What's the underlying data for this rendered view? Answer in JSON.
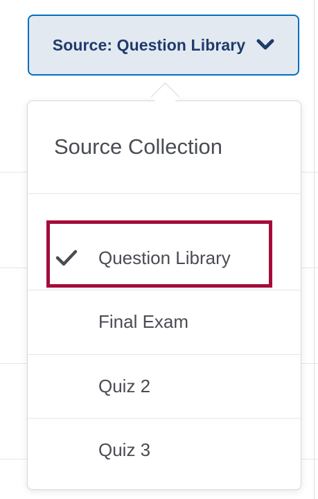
{
  "source_button": {
    "label": "Source: Question Library",
    "icon": "chevron-down-icon",
    "colors": {
      "background": "#e3e9f1",
      "border": "#006fbf",
      "text": "#1f3b6b"
    }
  },
  "dropdown": {
    "heading": "Source Collection",
    "items": [
      {
        "label": "Question Library",
        "selected": true,
        "icon": "check-icon"
      },
      {
        "label": "Final Exam",
        "selected": false
      },
      {
        "label": "Quiz 2",
        "selected": false
      },
      {
        "label": "Quiz 3",
        "selected": false
      }
    ]
  },
  "highlight_color": "#a50c3a"
}
